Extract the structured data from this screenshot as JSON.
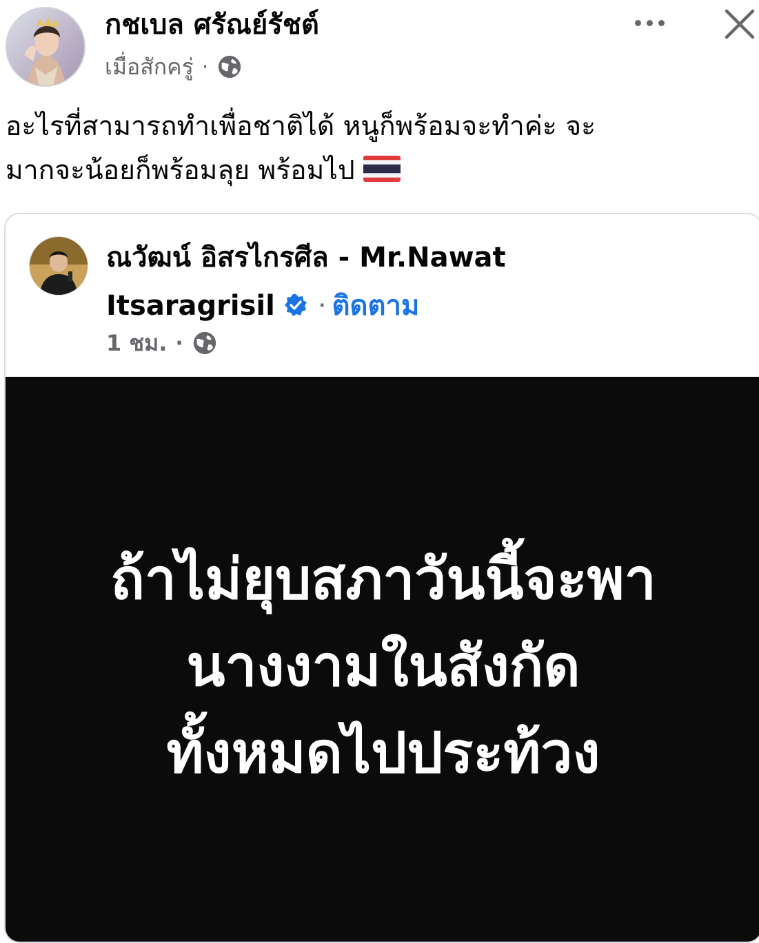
{
  "post": {
    "author_name": "กชเบล ศรัณย์รัชต์",
    "time": "เมื่อสักครู่",
    "meta_separator": "·",
    "caption_line1": "อะไรที่สามารถทำเพื่อชาติได้ หนูก็พร้อมจะทำค่ะ จะ",
    "caption_line2": "มากจะน้อยก็พร้อมลุย พร้อมไป",
    "caption_emoji": "thailand-flag"
  },
  "shared_post": {
    "author_name_thai": "ณวัฒน์ อิสรไกรศีล",
    "author_name_sep": "-",
    "author_name_en_1": "Mr.Nawat",
    "author_name_en_2": "Itsaragrisil",
    "follow_separator": "·",
    "follow_label": "ติดตาม",
    "time": "1 ชม.",
    "meta_separator": "·",
    "image_text": {
      "line1": "ถ้าไม่ยุบสภาวันนี้จะพา",
      "line2": "นางงามในสังกัด",
      "line3": "ทั้งหมดไปประท้วง"
    }
  },
  "icons": {
    "more": "more-horizontal-icon",
    "close": "close-icon",
    "privacy": "globe-icon",
    "verified": "verified-badge-icon"
  },
  "colors": {
    "primary_text": "#050505",
    "secondary_text": "#65676b",
    "link_blue": "#1b74e4",
    "image_background": "#0b0b0b",
    "image_text": "#ffffff"
  }
}
